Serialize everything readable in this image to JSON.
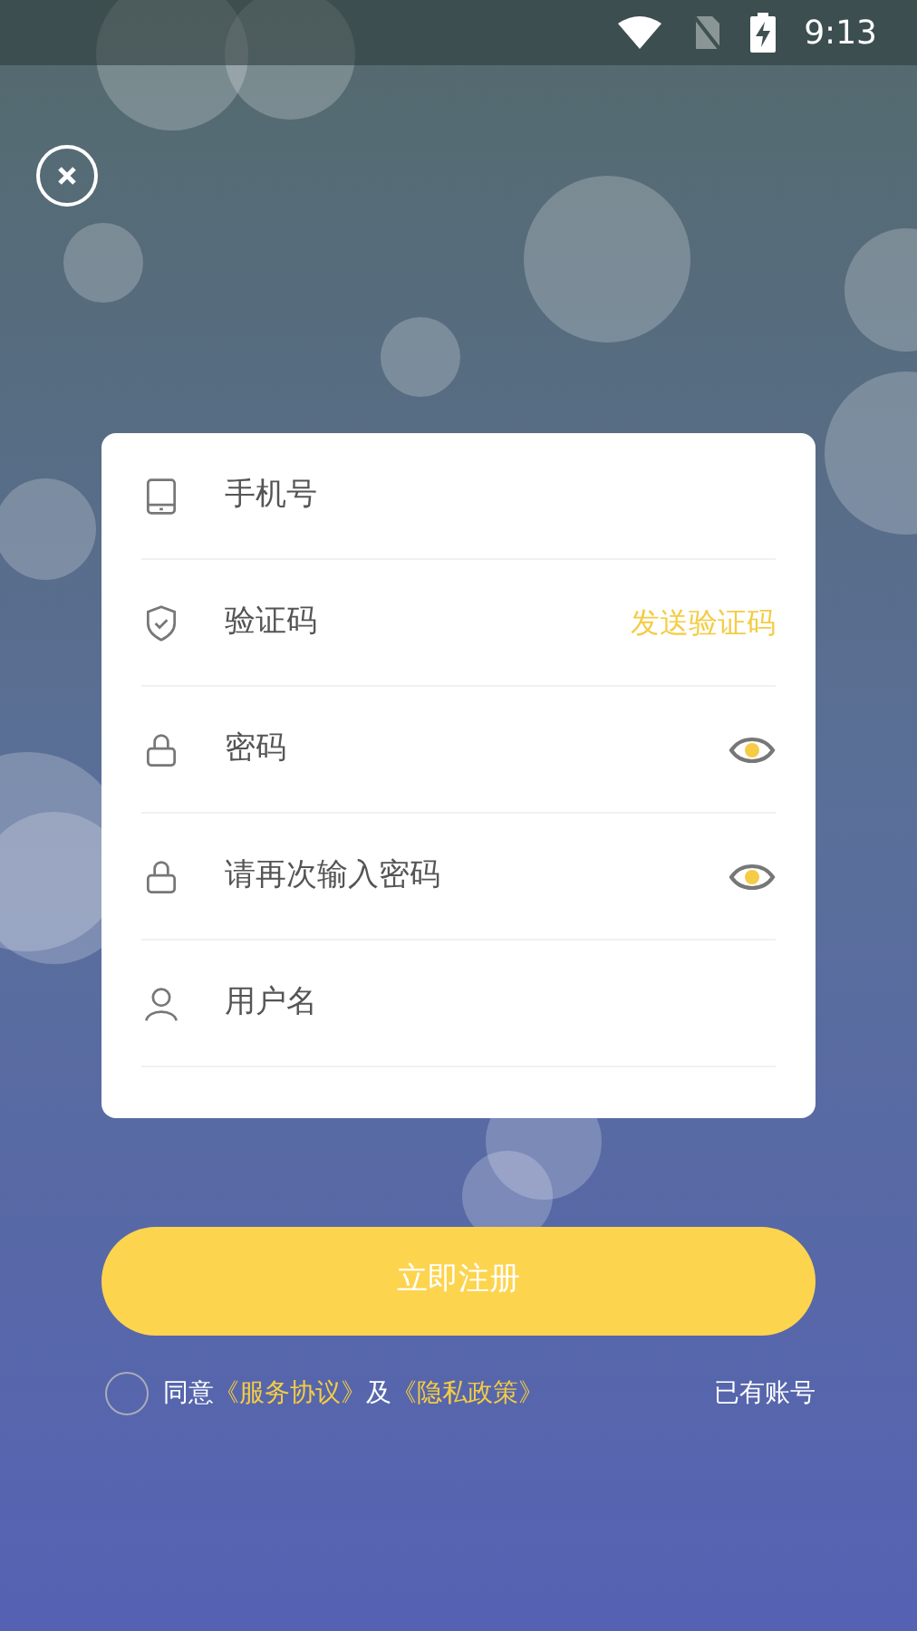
{
  "status_bar": {
    "time": "9:13"
  },
  "form": {
    "fields": [
      {
        "kind": "phone",
        "placeholder": "手机号"
      },
      {
        "kind": "code",
        "placeholder": "验证码",
        "action": "发送验证码"
      },
      {
        "kind": "password",
        "placeholder": "密码"
      },
      {
        "kind": "password",
        "placeholder": "请再次输入密码"
      },
      {
        "kind": "user",
        "placeholder": "用户名"
      }
    ]
  },
  "submit": {
    "label": "立即注册"
  },
  "agreement": {
    "checked": false,
    "prefix": "同意",
    "link_1": "《服务协议》",
    "joiner": "及",
    "link_2": "《隐私政策》"
  },
  "login_link": "已有账号"
}
